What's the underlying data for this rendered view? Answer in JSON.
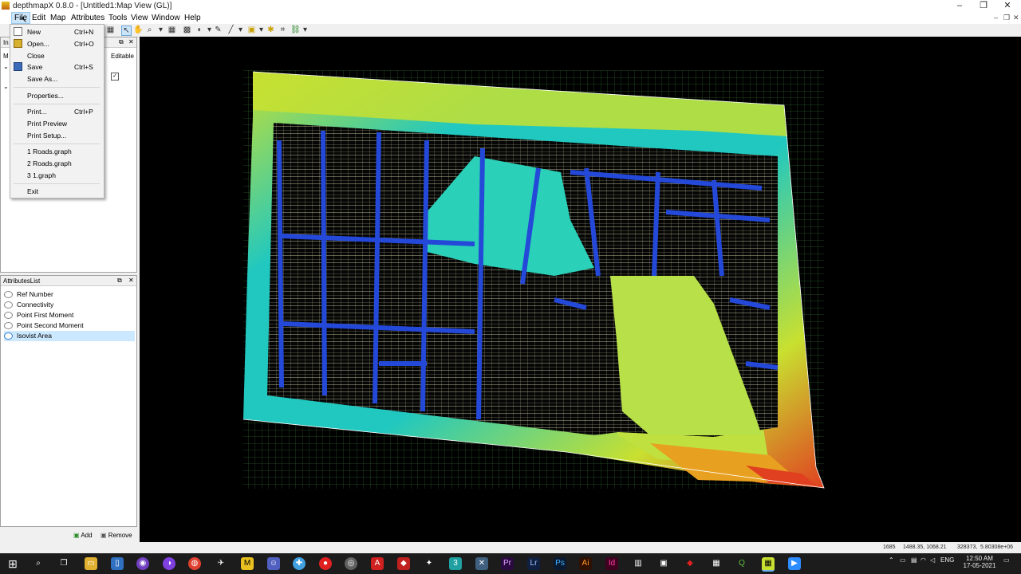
{
  "window": {
    "title": "depthmapX 0.8.0 - [Untitled1:Map View (GL)]",
    "controls": {
      "minimize": "–",
      "maximize": "❐",
      "close": "✕"
    }
  },
  "menubar": {
    "items": [
      "File",
      "Edit",
      "Map",
      "Attributes",
      "Tools",
      "View",
      "Window",
      "Help"
    ]
  },
  "file_menu": {
    "items": [
      {
        "label": "New",
        "shortcut": "Ctrl+N"
      },
      {
        "label": "Open...",
        "shortcut": "Ctrl+O"
      },
      {
        "label": "Close",
        "shortcut": ""
      },
      {
        "label": "Save",
        "shortcut": "Ctrl+S"
      },
      {
        "label": "Save As...",
        "shortcut": ""
      },
      {
        "label": "Properties...",
        "shortcut": ""
      },
      {
        "label": "Print...",
        "shortcut": "Ctrl+P"
      },
      {
        "label": "Print Preview",
        "shortcut": ""
      },
      {
        "label": "Print Setup...",
        "shortcut": ""
      },
      {
        "label": "1 Roads.graph",
        "shortcut": ""
      },
      {
        "label": "2 Roads.graph",
        "shortcut": ""
      },
      {
        "label": "3 1.graph",
        "shortcut": ""
      },
      {
        "label": "Exit",
        "shortcut": ""
      }
    ]
  },
  "index_panel": {
    "header_fragment": "In",
    "editable_label": "Editable",
    "tree_fragment": "M"
  },
  "attributes_panel": {
    "title": "AttributesList",
    "items": [
      "Ref Number",
      "Connectivity",
      "Point First Moment",
      "Point Second Moment",
      "Isovist Area"
    ],
    "selected_index": 4,
    "add_label": "Add",
    "remove_label": "Remove"
  },
  "statusbar": {
    "count": "1685",
    "coords": "1488.35, 1068.21",
    "value1": "328373,",
    "value2": "5.80308e+06"
  },
  "taskbar": {
    "lang": "ENG",
    "time": "12:50 AM",
    "date": "17-05-2021"
  },
  "colors": {
    "map_background": "#000000",
    "grid_line": "#2a5a2a",
    "low_value": "#2448d8",
    "mid_value": "#20c8c0",
    "high_value": "#c8e030",
    "peak_value": "#e04020",
    "selection": "#cce8ff"
  }
}
